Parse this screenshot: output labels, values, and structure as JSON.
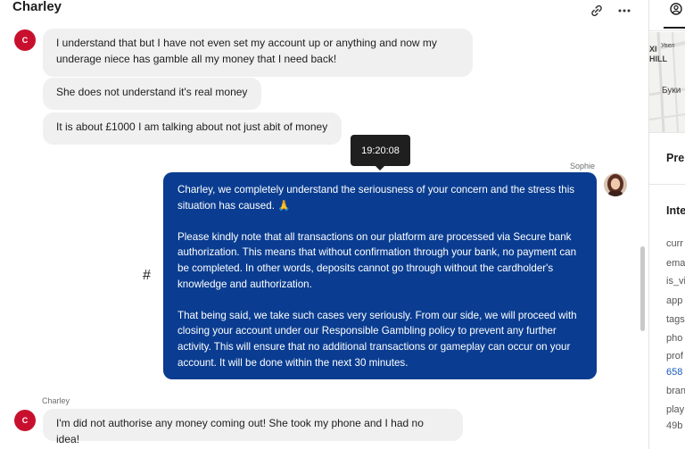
{
  "chat": {
    "title": "Charley",
    "icons": {
      "link": "link-icon",
      "more": "more-horizontal-icon"
    },
    "messages": [
      {
        "from": "customer",
        "text": "I understand that but I have not even set my account up or anything and now my\nunderage niece has gamble all my money that I need back!"
      },
      {
        "from": "customer",
        "text": "She does not understand it's real money"
      },
      {
        "from": "customer",
        "text": "It is about £1000 I am talking about not just abit of money"
      }
    ],
    "customer_initial": "C",
    "tooltip_time": "19:20:08",
    "agent_name": "Sophie",
    "agent_message": "Charley, we completely understand the seriousness of your concern and the stress this situation has caused. 🙏\n\nPlease kindly note that all transactions on our platform are processed via Secure bank authorization. This means that without confirmation through your bank, no payment can be completed. In other words, deposits cannot go through without the cardholder's knowledge and authorization.\n\nThat being said, we take such cases very seriously. From our side, we will proceed with closing your account under our Responsible Gambling policy to prevent any further activity. This will ensure that no additional transactions or gameplay can occur on your account. It will be done within the next 30 minutes.",
    "hash_symbol": "#",
    "second_sender": "Charley",
    "last_message": "I'm did not authorise any money coming out! She took my phone and I had no idea!"
  },
  "panel": {
    "tab_icon": "user-circle-icon",
    "map_labels": [
      "Увел",
      "XI",
      "HILL",
      "Буки"
    ],
    "heading_1": "Pre",
    "heading_2": "Inte",
    "fields": [
      "curr",
      "ema",
      "is_vi",
      "app",
      "tags",
      "pho",
      "prof",
      "658",
      "bran",
      "play",
      "49b"
    ]
  },
  "colors": {
    "agent_bubble": "#0a3d91",
    "customer_bubble": "#f0f0f0",
    "avatar": "#c8102e",
    "link": "#1a5bbf"
  }
}
